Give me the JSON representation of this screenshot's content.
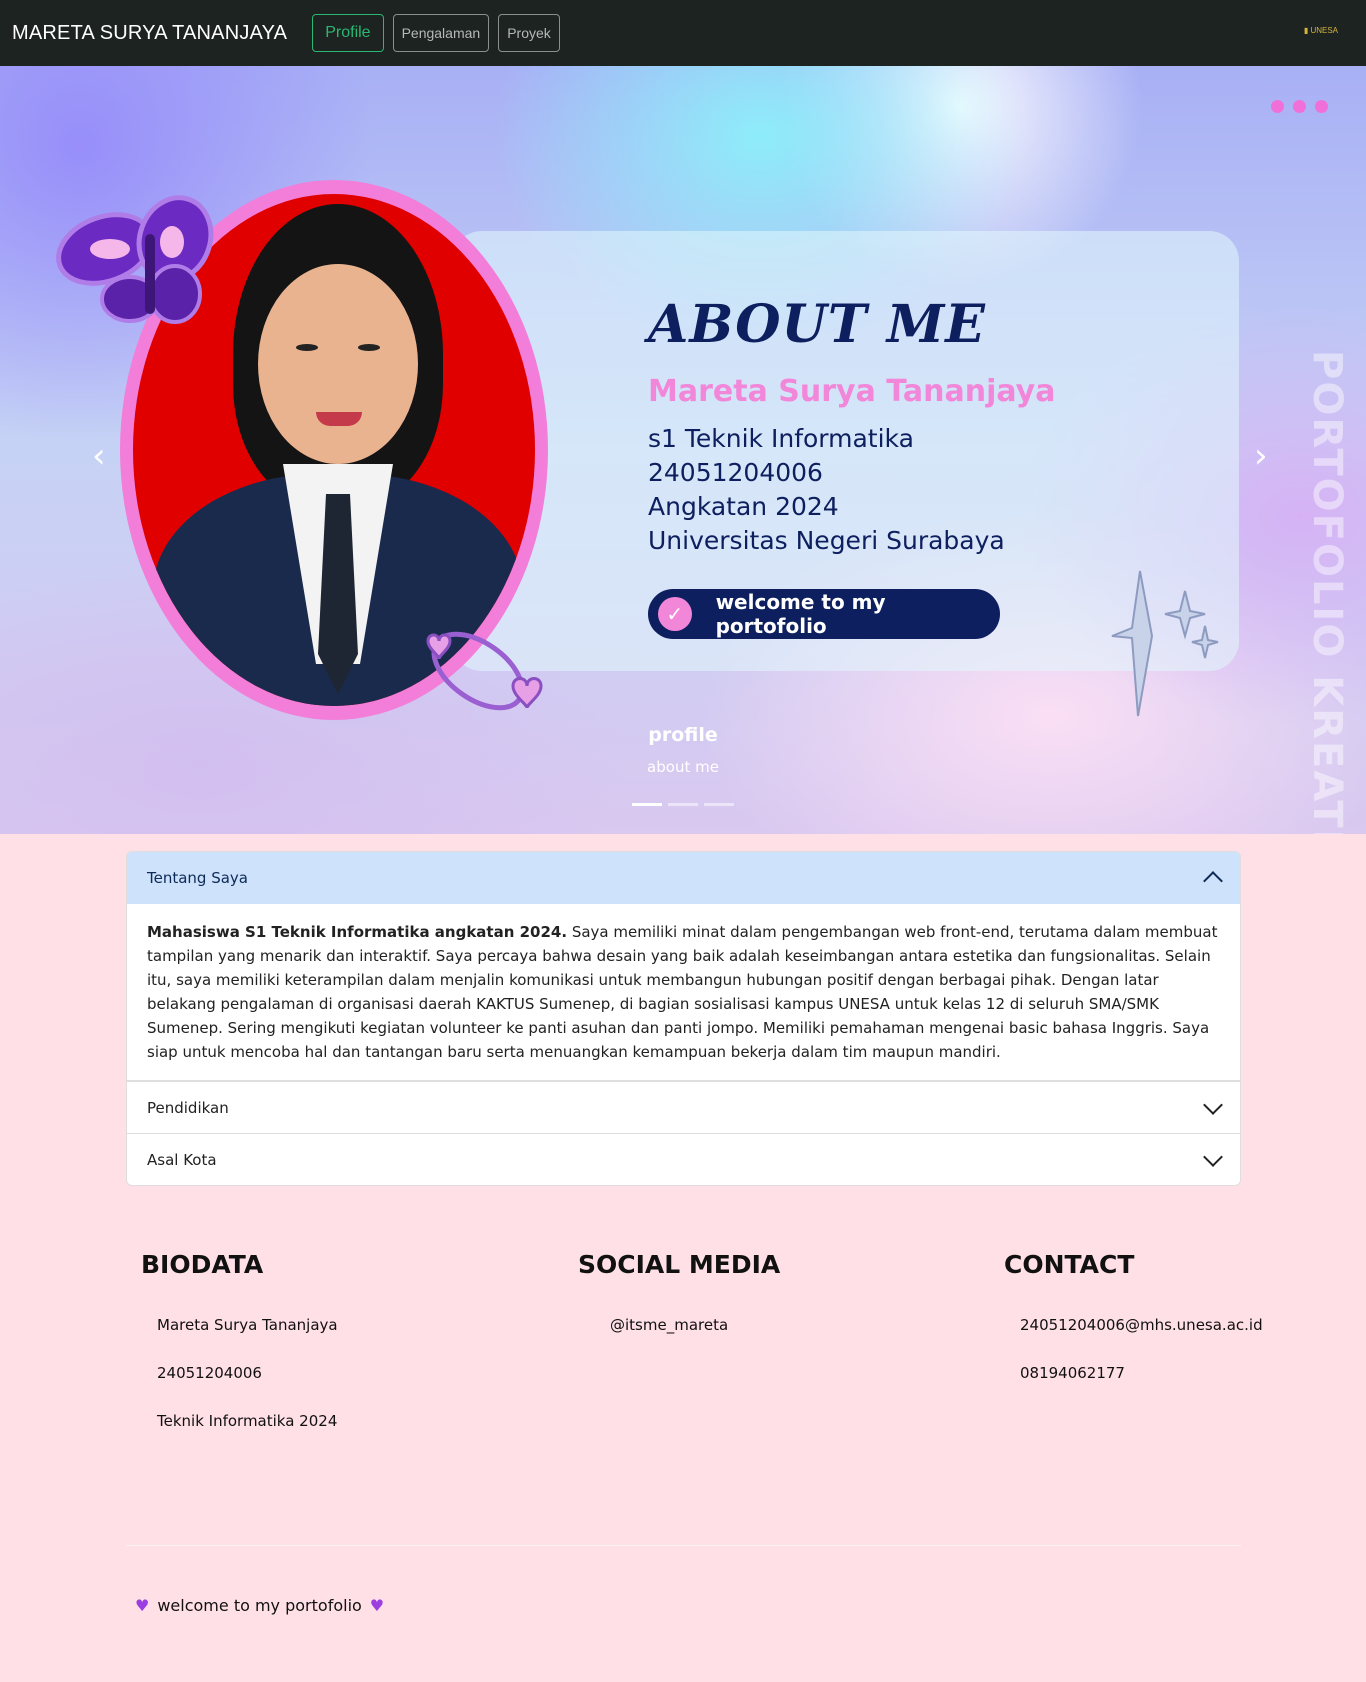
{
  "navbar": {
    "brand": "MARETA SURYA TANANJAYA",
    "buttons": [
      "Profile",
      "Pengalaman",
      "Proyek"
    ],
    "logo_text": "UNESA"
  },
  "hero": {
    "title": "ABOUT ME",
    "name": "Mareta Surya Tananjaya",
    "lines": [
      "s1 Teknik Informatika",
      "24051204006",
      "Angkatan 2024",
      "Universitas Negeri Surabaya"
    ],
    "welcome": "welcome to my portofolio",
    "side_text": "PORTOFOLIO KREATIF",
    "caption_title": "profile",
    "caption_sub": "about me",
    "prev_icon": "chevron-left-icon",
    "next_icon": "chevron-right-icon",
    "accent_pink": "#f286d9",
    "accent_navy": "#0d1f5e",
    "slide_count": 3,
    "active_slide": 1
  },
  "accordion": [
    {
      "title": "Tentang Saya",
      "open": true,
      "body_bold": "Mahasiswa S1 Teknik Informatika angkatan 2024.",
      "body": " Saya memiliki minat dalam pengembangan web front-end, terutama dalam membuat tampilan yang menarik dan interaktif. Saya percaya bahwa desain yang baik adalah keseimbangan antara estetika dan fungsionalitas. Selain itu, saya memiliki keterampilan dalam menjalin komunikasi untuk membangun hubungan positif dengan berbagai pihak. Dengan latar belakang pengalaman di organisasi daerah KAKTUS Sumenep, di bagian sosialisasi kampus UNESA untuk kelas 12 di seluruh SMA/SMK Sumenep. Sering mengikuti kegiatan volunteer ke panti asuhan dan panti jompo. Memiliki pemahaman mengenai basic bahasa Inggris. Saya siap untuk mencoba hal dan tantangan baru serta menuangkan kemampuan bekerja dalam tim maupun mandiri."
    },
    {
      "title": "Pendidikan",
      "open": false
    },
    {
      "title": "Asal Kota",
      "open": false
    }
  ],
  "footer": {
    "biodata": {
      "title": "BIODATA",
      "items": [
        "Mareta Surya Tananjaya",
        "24051204006",
        "Teknik Informatika 2024"
      ]
    },
    "social": {
      "title": "SOCIAL MEDIA",
      "items": [
        "@itsme_mareta"
      ]
    },
    "contact": {
      "title": "CONTACT",
      "items": [
        "24051204006@mhs.unesa.ac.id",
        "08194062177"
      ]
    },
    "note": "welcome to my portofolio"
  }
}
